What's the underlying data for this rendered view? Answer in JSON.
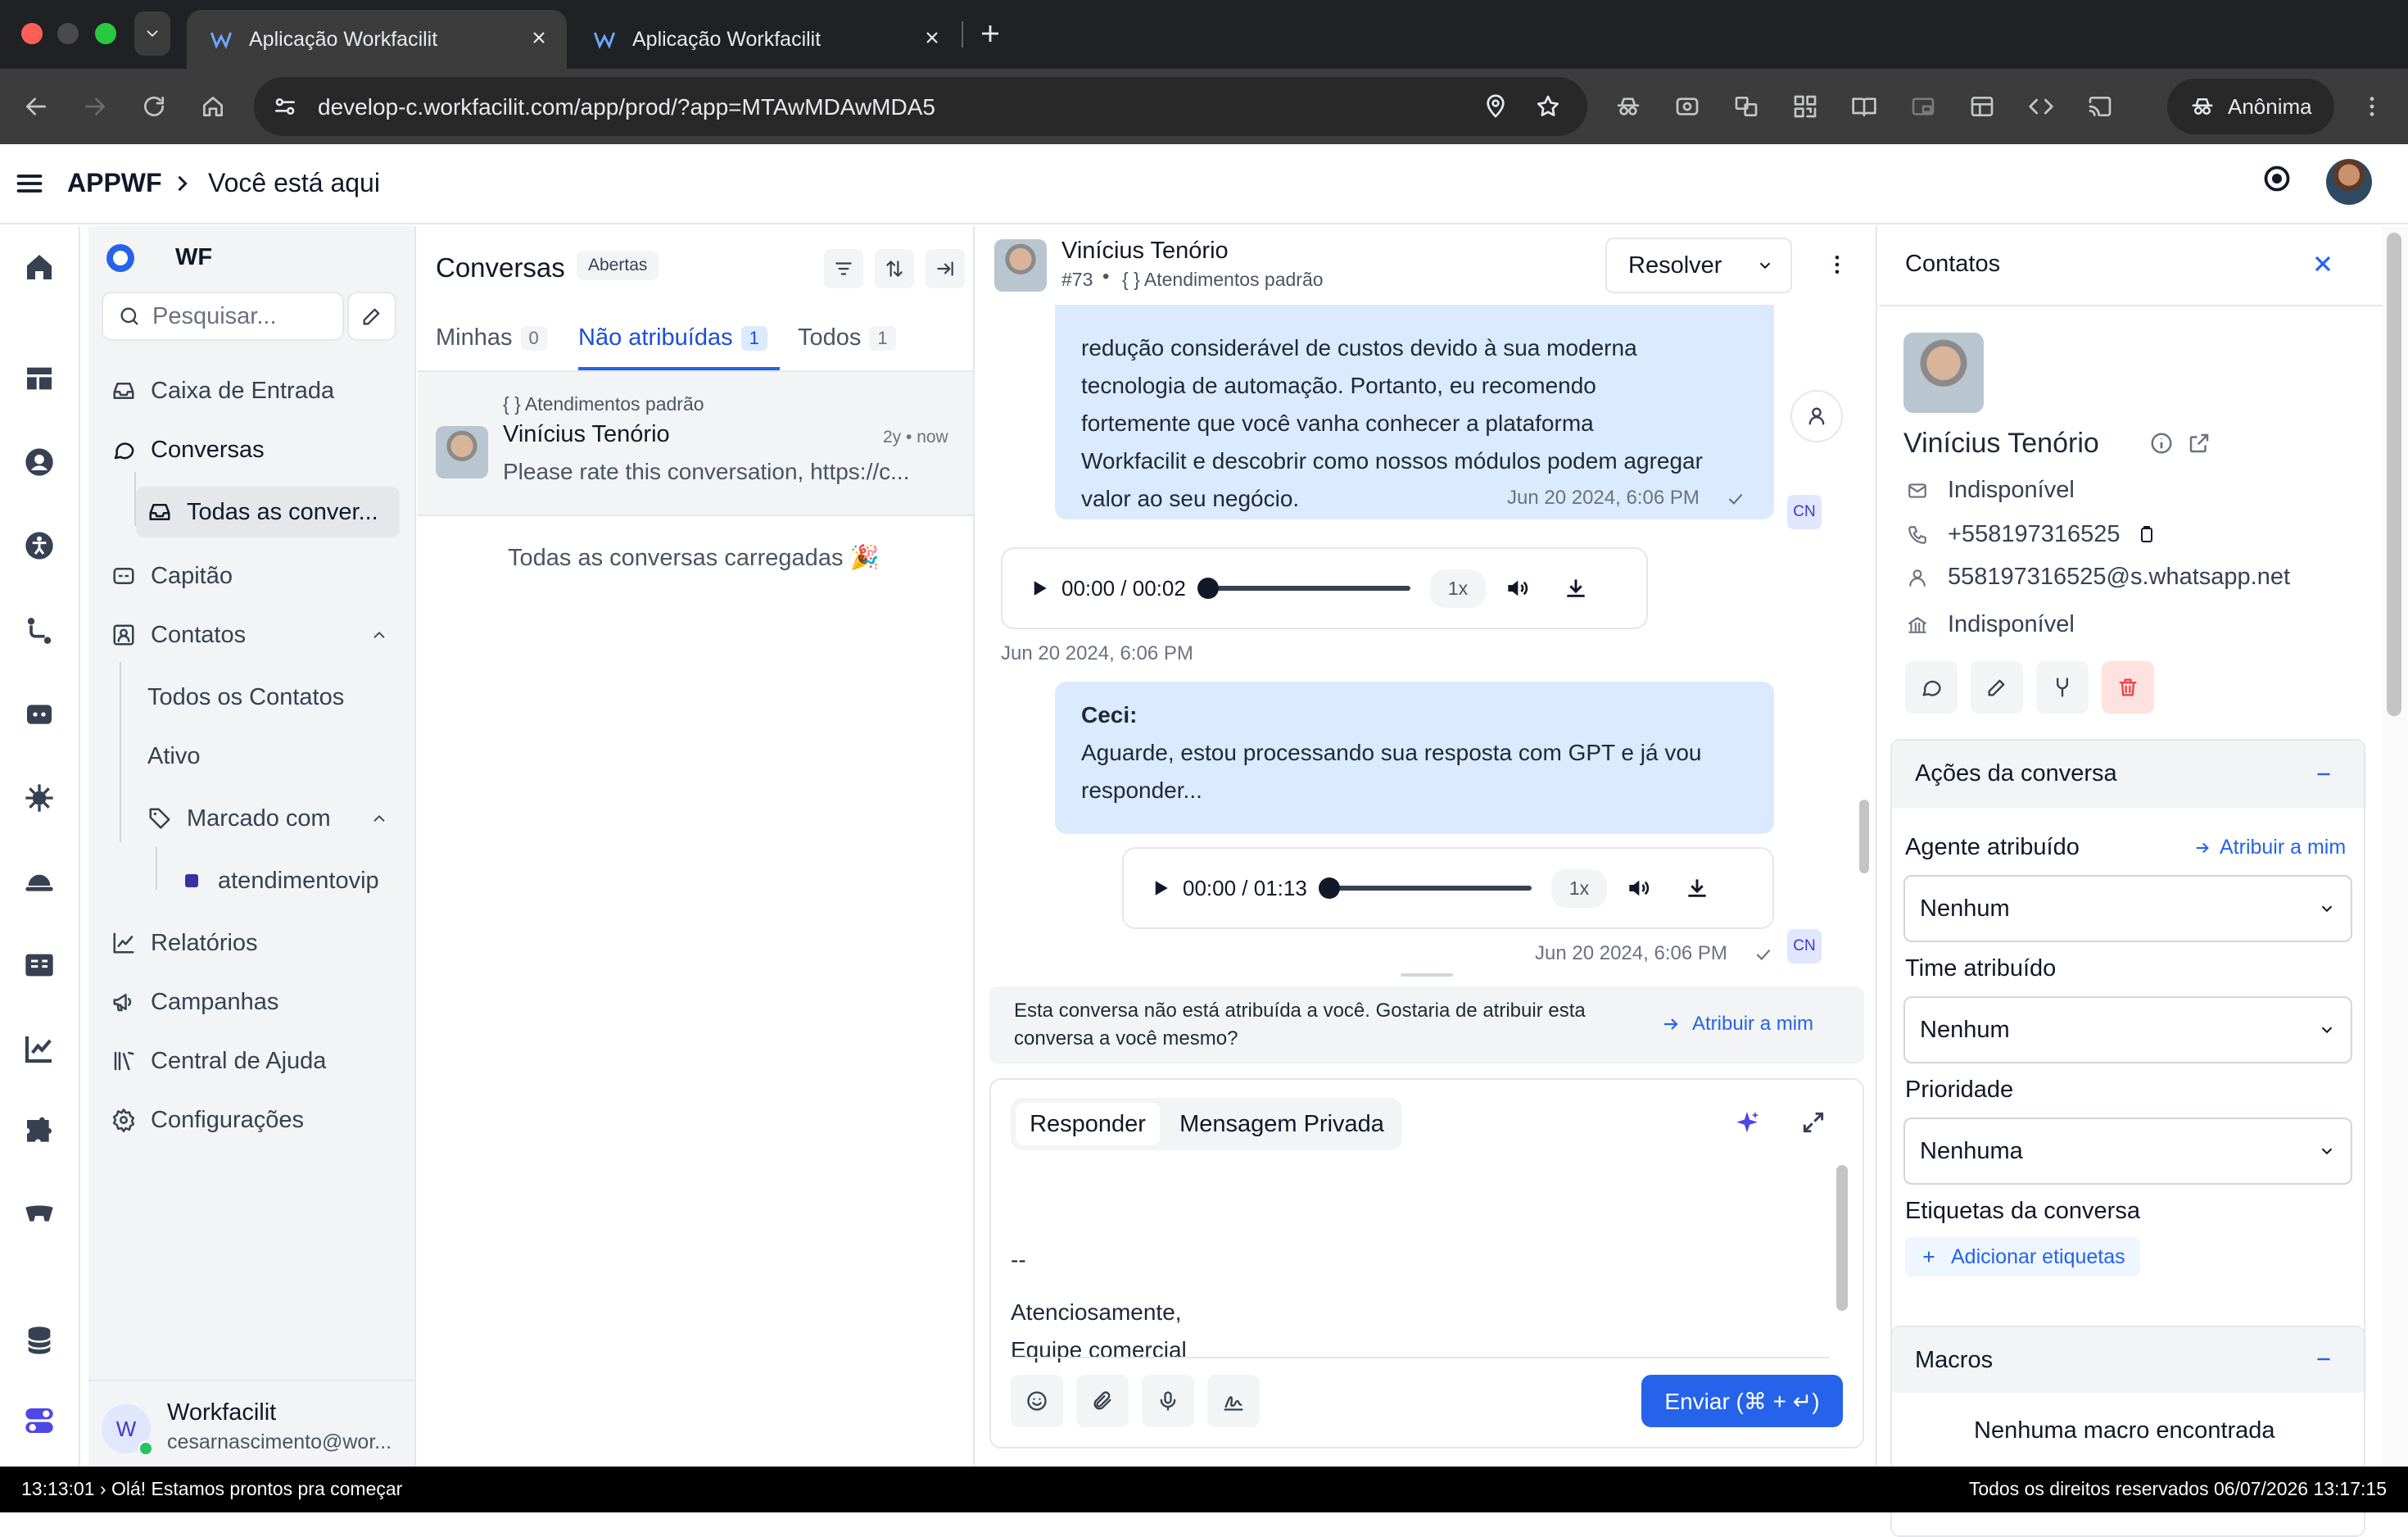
{
  "browser": {
    "tabs": [
      {
        "title": "Aplicação Workfacilit",
        "active": true
      },
      {
        "title": "Aplicação Workfacilit",
        "active": false
      }
    ],
    "url": "develop-c.workfacilit.com/app/prod/?app=MTAwMDAwMDA5",
    "profile_label": "Anônima"
  },
  "header": {
    "app_name": "APPWF",
    "breadcrumb": "Você está aqui"
  },
  "sidebar": {
    "account_initials": "WF",
    "search_placeholder": "Pesquisar...",
    "items": {
      "inbox": "Caixa de Entrada",
      "conversations": "Conversas",
      "all_conversations": "Todas as conver...",
      "captain": "Capitão",
      "contacts": "Contatos",
      "all_contacts": "Todos os Contatos",
      "active": "Ativo",
      "tagged_with": "Marcado com",
      "tag_vip": "atendimentovip",
      "reports": "Relatórios",
      "campaigns": "Campanhas",
      "help_center": "Central de Ajuda",
      "settings": "Configurações"
    },
    "user": {
      "avatar_letter": "W",
      "name": "Workfacilit",
      "email": "cesarnascimento@wor..."
    }
  },
  "conversations": {
    "title": "Conversas",
    "status_badge": "Abertas",
    "tabs": [
      {
        "label": "Minhas",
        "count": "0"
      },
      {
        "label": "Não atribuídas",
        "count": "1"
      },
      {
        "label": "Todos",
        "count": "1"
      }
    ],
    "active_tab": "Não atribuídas",
    "items": [
      {
        "inbox": "{ } Atendimentos padrão",
        "name": "Vinícius Tenório",
        "time": "2y • now",
        "preview": "Please rate this conversation, https://c..."
      }
    ],
    "loaded_message": "Todas as conversas carregadas 🎉"
  },
  "chat": {
    "contact_name": "Vinícius Tenório",
    "conversation_id": "#73",
    "inbox": "{ } Atendimentos padrão",
    "resolve_button": "Resolver",
    "messages": [
      {
        "lines": [
          "redução considerável de custos devido à sua moderna",
          "tecnologia de automação. Portanto, eu recomendo",
          "fortemente que você vanha conhecer a plataforma",
          "Workfacilit e descobrir como nossos módulos podem agregar",
          "valor ao seu negócio."
        ],
        "time": "Jun 20 2024, 6:06 PM"
      },
      {
        "audio_time": "00:00 / 00:02",
        "speed": "1x",
        "progress": 0,
        "time": "Jun 20 2024, 6:06 PM"
      },
      {
        "sender": "Ceci:",
        "lines": [
          "Aguarde, estou processando sua resposta com GPT e já vou",
          "responder..."
        ]
      },
      {
        "audio_time": "00:00 / 01:13",
        "speed": "1x",
        "progress": 0,
        "time": "Jun 20 2024, 6:06 PM"
      }
    ],
    "agent_initials": "CN",
    "assign_notice": [
      "Esta conversa não está atribuída a você. Gostaria de atribuir esta",
      "conversa a você mesmo?"
    ],
    "assign_link": "Atribuir a mim",
    "composer": {
      "mode_reply": "Responder",
      "mode_private": "Mensagem Privada",
      "text_lines": [
        "--",
        "Atenciosamente,",
        "Equipe comercial"
      ],
      "send_button": "Enviar (⌘ + ↵)"
    }
  },
  "contact_panel": {
    "title": "Contatos",
    "name": "Vinícius Tenório",
    "email": "Indisponível",
    "phone": "+558197316525",
    "whatsapp": "558197316525@s.whatsapp.net",
    "company": "Indisponível",
    "actions_section": "Ações da conversa",
    "assigned_agent_label": "Agente atribuído",
    "assign_to_me": "Atribuir a mim",
    "assigned_agent_value": "Nenhum",
    "team_label": "Time atribuído",
    "team_value": "Nenhum",
    "priority_label": "Prioridade",
    "priority_value": "Nenhuma",
    "labels_label": "Etiquetas da conversa",
    "add_labels": "Adicionar etiquetas",
    "macros_section": "Macros",
    "no_macros": "Nenhuma macro encontrada"
  },
  "statusbar": {
    "left": "13:13:01 › Olá! Estamos prontos pra começar",
    "right": "Todos os direitos reservados 06/07/2026 13:17:15"
  },
  "colors": {
    "accent": "#2563eb",
    "bubble": "#dbeafe",
    "sidebar_bg": "#f3f4f6",
    "delete_red": "#ef4444",
    "browser_dark": "#202124"
  }
}
